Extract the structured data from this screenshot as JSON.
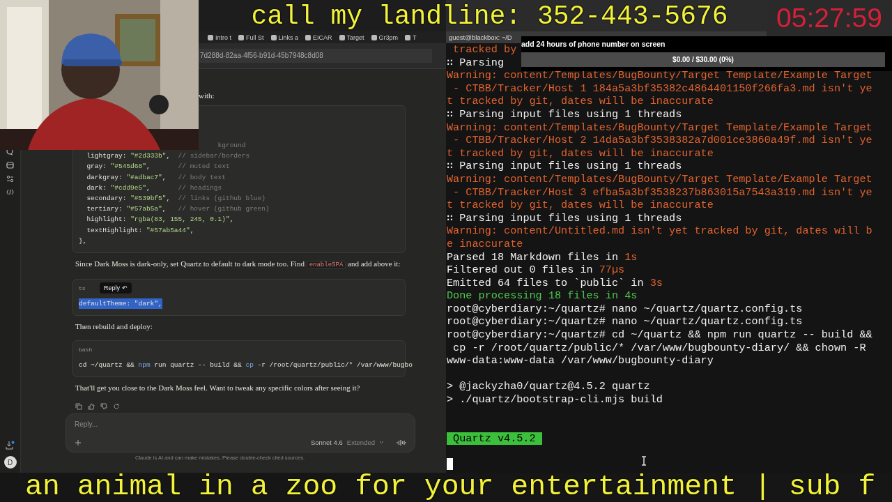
{
  "stream_overlay": {
    "banner": "call my landline: 352-443-5676",
    "timer": "05:27:59",
    "goal": {
      "title": "add 24 hours of phone number on screen",
      "reading": "$0.00 / $30.00 (0%)",
      "level": 0
    },
    "ticker": "an animal in a zoo for your entertainment | sub f"
  },
  "browser": {
    "bookmarks": [
      "Intro t",
      "Full St",
      "Links a",
      "EICAR",
      "Target",
      "Gr3pm",
      "T"
    ],
    "address": "7d288d-82aa-4f56-b91d-45b7948c8d08",
    "avatar": "D",
    "chat": [
      {
        "kind": "fragment",
        "parts": [
          {
            "text": "with:"
          }
        ]
      },
      {
        "kind": "code",
        "lines": [
          {
            "kind": "partial",
            "segs": [
              {
                "kind": "comment",
                "t": "kground"
              }
            ]
          },
          {
            "segs": [
              {
                "kind": "plain",
                "t": "  lightgray: "
              },
              {
                "kind": "string",
                "t": "\"#2d333b\""
              },
              {
                "kind": "plain",
                "t": ",  "
              },
              {
                "kind": "comment",
                "t": "// sidebar/borders"
              }
            ]
          },
          {
            "segs": [
              {
                "kind": "plain",
                "t": "  gray: "
              },
              {
                "kind": "string",
                "t": "\"#545d68\""
              },
              {
                "kind": "plain",
                "t": ",       "
              },
              {
                "kind": "comment",
                "t": "// muted text"
              }
            ]
          },
          {
            "segs": [
              {
                "kind": "plain",
                "t": "  darkgray: "
              },
              {
                "kind": "string",
                "t": "\"#adbac7\""
              },
              {
                "kind": "plain",
                "t": ",   "
              },
              {
                "kind": "comment",
                "t": "// body text"
              }
            ]
          },
          {
            "segs": [
              {
                "kind": "plain",
                "t": "  dark: "
              },
              {
                "kind": "string",
                "t": "\"#cdd9e5\""
              },
              {
                "kind": "plain",
                "t": ",       "
              },
              {
                "kind": "comment",
                "t": "// headings"
              }
            ]
          },
          {
            "segs": [
              {
                "kind": "plain",
                "t": "  secondary: "
              },
              {
                "kind": "string",
                "t": "\"#539bf5\""
              },
              {
                "kind": "plain",
                "t": ",  "
              },
              {
                "kind": "comment",
                "t": "// links (github blue)"
              }
            ]
          },
          {
            "segs": [
              {
                "kind": "plain",
                "t": "  tertiary: "
              },
              {
                "kind": "string",
                "t": "\"#57ab5a\""
              },
              {
                "kind": "plain",
                "t": ",   "
              },
              {
                "kind": "comment",
                "t": "// hover (github green)"
              }
            ]
          },
          {
            "segs": [
              {
                "kind": "plain",
                "t": "  highlight: "
              },
              {
                "kind": "string",
                "t": "\"rgba(83, 155, 245, 0.1)\""
              },
              {
                "kind": "plain",
                "t": ","
              }
            ]
          },
          {
            "segs": [
              {
                "kind": "plain",
                "t": "  textHighlight: "
              },
              {
                "kind": "string",
                "t": "\"#57ab5a44\""
              },
              {
                "kind": "plain",
                "t": ","
              }
            ]
          },
          {
            "segs": [
              {
                "kind": "plain",
                "t": "},"
              }
            ]
          }
        ]
      },
      {
        "kind": "text",
        "parts": [
          {
            "text": "Since Dark Moss is dark-only, set Quartz to default to dark mode too. Find "
          },
          {
            "text": "enableSPA",
            "kind": "code"
          },
          {
            "text": " and add above it:"
          }
        ]
      },
      {
        "kind": "code",
        "lang": "ts",
        "reply_button": "Reply ↶",
        "lines": [
          {
            "selected": true,
            "segs": [
              {
                "kind": "plain",
                "t": "defaultTheme: \"dark\","
              }
            ]
          }
        ]
      },
      {
        "kind": "text",
        "parts": [
          {
            "text": "Then rebuild and deploy:"
          }
        ]
      },
      {
        "kind": "code",
        "lang": "bash",
        "lines": [
          {
            "segs": [
              {
                "kind": "plain",
                "t": "cd ~/quartz && "
              },
              {
                "kind": "command",
                "t": "npm"
              },
              {
                "kind": "plain",
                "t": " run quartz -- build && "
              },
              {
                "kind": "command",
                "t": "cp"
              },
              {
                "kind": "plain",
                "t": " -r /root/quartz/public/* /var/www/bugbo"
              }
            ]
          }
        ]
      },
      {
        "kind": "text",
        "parts": [
          {
            "text": "That'll get you close to the Dark Moss feel. Want to tweak any specific colors after seeing it?"
          }
        ]
      }
    ],
    "composer": {
      "placeholder": "Reply...",
      "model": "Sonnet 4.6",
      "mode": "Extended"
    },
    "disclaimer": "Claude is AI and can make mistakes. Please double-check cited sources."
  },
  "terminal": {
    "tab": "guest@blackbox: ~/D",
    "lines": [
      {
        "segs": [
          {
            "kind": "warn",
            "t": " tracked by"
          }
        ]
      },
      {
        "segs": [
          {
            "kind": "plain",
            "t": "∷ Parsing"
          }
        ]
      },
      {
        "segs": [
          {
            "kind": "warn",
            "t": "Warning: content/Templates/BugBounty/Target Template/Example Target"
          }
        ]
      },
      {
        "segs": [
          {
            "kind": "warn",
            "t": " - CTBB/Tracker/Host 1 184a5a3bf35382c4864401150f266fa3.md isn't ye"
          }
        ]
      },
      {
        "segs": [
          {
            "kind": "warn",
            "t": "t tracked by git, dates will be inaccurate"
          }
        ]
      },
      {
        "segs": [
          {
            "kind": "plain",
            "t": "∷ Parsing input files using 1 threads"
          }
        ]
      },
      {
        "segs": [
          {
            "kind": "warn",
            "t": "Warning: content/Templates/BugBounty/Target Template/Example Target"
          }
        ]
      },
      {
        "segs": [
          {
            "kind": "warn",
            "t": " - CTBB/Tracker/Host 2 14da5a3bf3538382a7d001ce3860a49f.md isn't ye"
          }
        ]
      },
      {
        "segs": [
          {
            "kind": "warn",
            "t": "t tracked by git, dates will be inaccurate"
          }
        ]
      },
      {
        "segs": [
          {
            "kind": "plain",
            "t": "∷ Parsing input files using 1 threads"
          }
        ]
      },
      {
        "segs": [
          {
            "kind": "warn",
            "t": "Warning: content/Templates/BugBounty/Target Template/Example Target"
          }
        ]
      },
      {
        "segs": [
          {
            "kind": "warn",
            "t": " - CTBB/Tracker/Host 3 efba5a3bf3538237b863015a7543a319.md isn't ye"
          }
        ]
      },
      {
        "segs": [
          {
            "kind": "warn",
            "t": "t tracked by git, dates will be inaccurate"
          }
        ]
      },
      {
        "segs": [
          {
            "kind": "plain",
            "t": "∷ Parsing input files using 1 threads"
          }
        ]
      },
      {
        "segs": [
          {
            "kind": "warn",
            "t": "Warning: content/Untitled.md isn't yet tracked by git, dates will b"
          }
        ]
      },
      {
        "segs": [
          {
            "kind": "warn",
            "t": "e inaccurate"
          }
        ]
      },
      {
        "segs": [
          {
            "kind": "plain",
            "t": "Parsed 18 Markdown files in "
          },
          {
            "kind": "warn",
            "t": "1s"
          }
        ]
      },
      {
        "segs": [
          {
            "kind": "plain",
            "t": "Filtered out 0 files in "
          },
          {
            "kind": "warn",
            "t": "77µs"
          }
        ]
      },
      {
        "segs": [
          {
            "kind": "plain",
            "t": "Emitted 64 files to `public` in "
          },
          {
            "kind": "warn",
            "t": "3s"
          }
        ]
      },
      {
        "segs": [
          {
            "kind": "ok",
            "t": "Done processing 18 files in 4s"
          }
        ]
      },
      {
        "segs": [
          {
            "kind": "plain",
            "t": "root@cyberdiary:~/quartz# nano ~/quartz/quartz.config.ts"
          }
        ]
      },
      {
        "segs": [
          {
            "kind": "plain",
            "t": "root@cyberdiary:~/quartz# nano ~/quartz/quartz.config.ts"
          }
        ]
      },
      {
        "segs": [
          {
            "kind": "plain",
            "t": "root@cyberdiary:~/quartz# cd ~/quartz && npm run quartz -- build &&"
          }
        ]
      },
      {
        "segs": [
          {
            "kind": "plain",
            "t": " cp -r /root/quartz/public/* /var/www/bugbounty-diary/ && chown -R"
          }
        ]
      },
      {
        "segs": [
          {
            "kind": "plain",
            "t": "www-data:www-data /var/www/bugbounty-diary"
          }
        ]
      },
      {
        "kind": "blank"
      },
      {
        "segs": [
          {
            "kind": "plain",
            "t": "> @jackyzha0/quartz@4.5.2 quartz"
          }
        ]
      },
      {
        "segs": [
          {
            "kind": "plain",
            "t": "> ./quartz/bootstrap-cli.mjs build"
          }
        ]
      },
      {
        "kind": "blank"
      },
      {
        "kind": "blank"
      },
      {
        "segs": [
          {
            "kind": "badge",
            "t": " Quartz v4.5.2 "
          }
        ]
      },
      {
        "kind": "blank"
      },
      {
        "kind": "cursor"
      }
    ]
  }
}
